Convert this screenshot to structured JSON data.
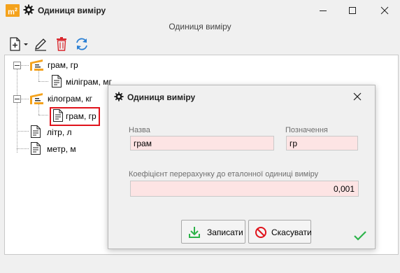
{
  "window": {
    "app_icon_text": "m",
    "app_icon_sup": "2",
    "title": "Одиниця виміру",
    "subtitle": "Одиниця виміру"
  },
  "toolbar": {
    "icons": [
      "new-document-icon",
      "edit-pencil-icon",
      "delete-trash-icon",
      "refresh-icon"
    ]
  },
  "tree": {
    "items": [
      {
        "label": "грам, гр",
        "icon": "base-unit-icon"
      },
      {
        "label": "міліграм, мг",
        "icon": "document-icon"
      },
      {
        "label": "кілограм, кг",
        "icon": "base-unit-icon"
      },
      {
        "label": "грам, гр",
        "icon": "document-icon",
        "selected": true
      },
      {
        "label": "літр, л",
        "icon": "document-icon"
      },
      {
        "label": "метр, м",
        "icon": "document-icon"
      }
    ]
  },
  "dialog": {
    "title": "Одиниця виміру",
    "name_label": "Назва",
    "name_value": "грам",
    "designation_label": "Позначення",
    "designation_value": "гр",
    "coef_label": "Коефіцієнт перерахунку до еталонної одиниці виміру",
    "coef_value": "0,001",
    "save_label": "Записати",
    "cancel_label": "Скасувати"
  },
  "colors": {
    "accent_orange": "#f4a21c",
    "selection_red": "#e0131c",
    "field_pink": "#fde4e4",
    "ok_green": "#2db34a",
    "refresh_blue": "#2a7fd4"
  }
}
